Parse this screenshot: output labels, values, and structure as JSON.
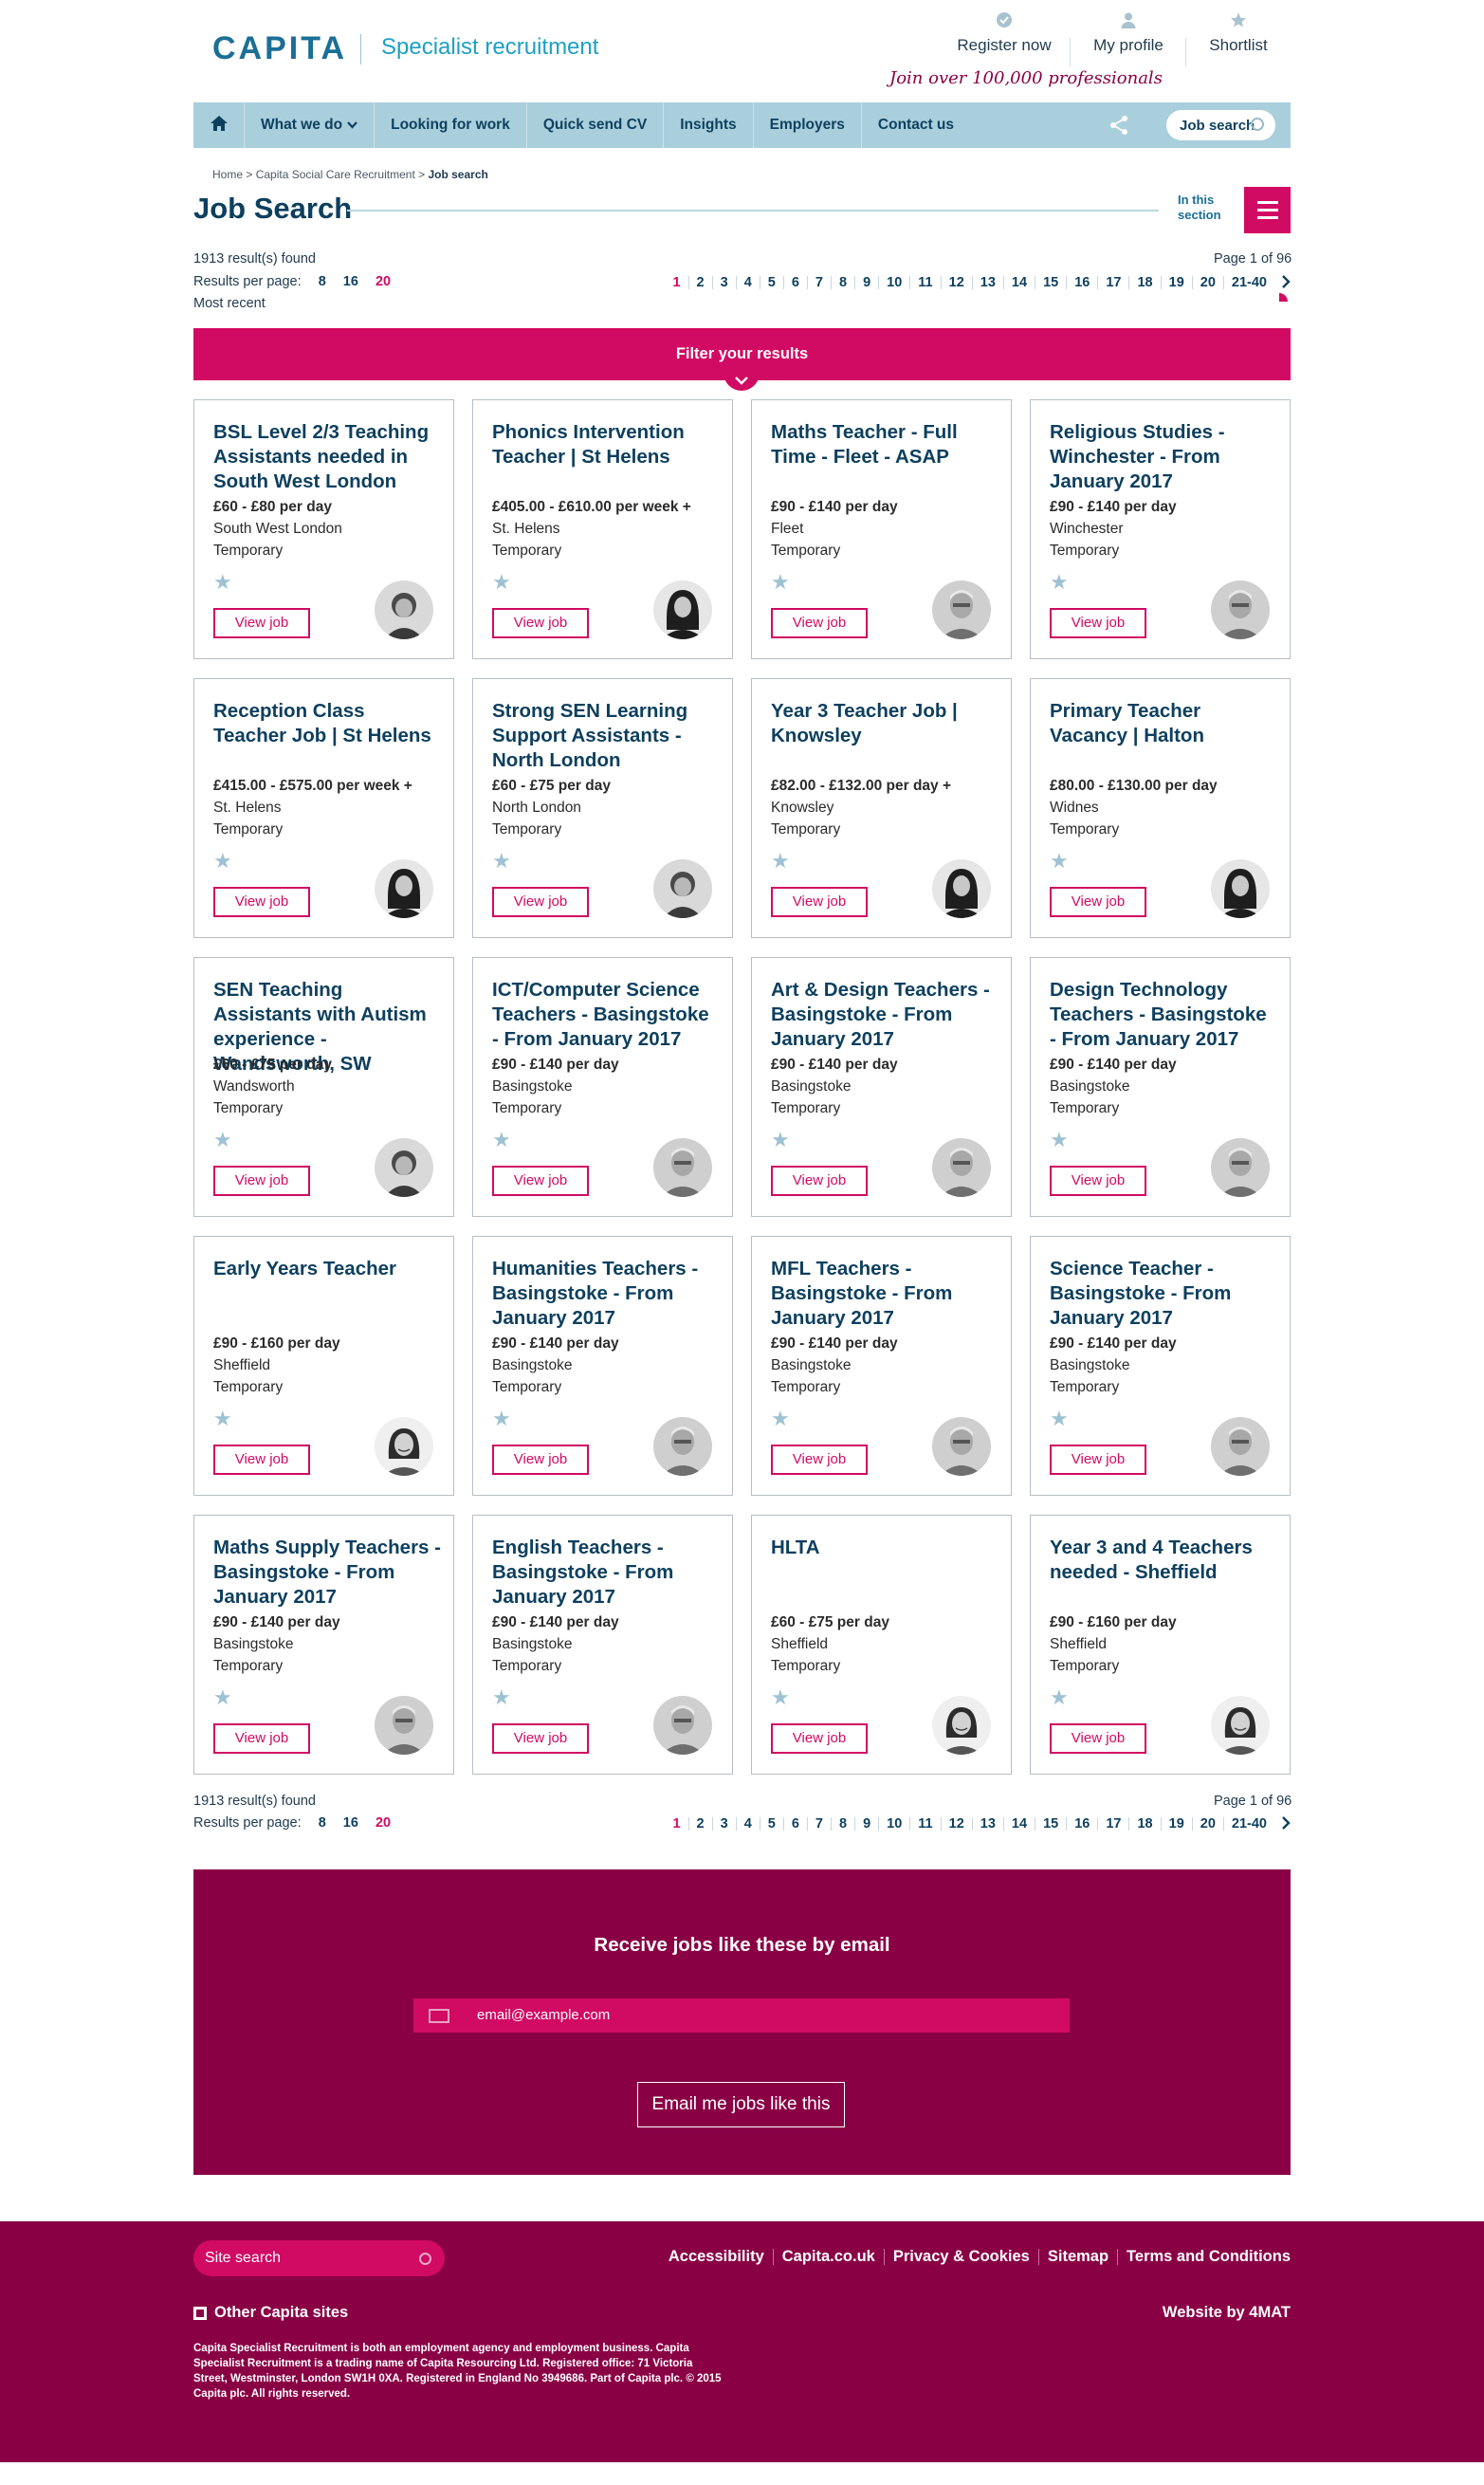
{
  "header": {
    "logo": "CAPITA",
    "tagline": "Specialist recruitment",
    "links": [
      {
        "label": "Register now",
        "icon": "check-icon"
      },
      {
        "label": "My profile",
        "icon": "person-icon"
      },
      {
        "label": "Shortlist",
        "icon": "star-icon"
      }
    ],
    "join_text": "Join over 100,000 professionals"
  },
  "nav": {
    "items": [
      "What we do",
      "Looking for work",
      "Quick send CV",
      "Insights",
      "Employers",
      "Contact us"
    ],
    "search_label": "Job search"
  },
  "breadcrumb": {
    "home": "Home",
    "section": "Capita Social Care Recruitment",
    "current": "Job search"
  },
  "page": {
    "title": "Job Search",
    "in_section": "In this section",
    "results_found": "1913 result(s) found",
    "results_per_page_label": "Results per page:",
    "per_page_options": [
      "8",
      "16",
      "20"
    ],
    "per_page_active": "20",
    "sort": "Most recent",
    "page_of": "Page 1 of 96",
    "pages": [
      "1",
      "2",
      "3",
      "4",
      "5",
      "6",
      "7",
      "8",
      "9",
      "10",
      "11",
      "12",
      "13",
      "14",
      "15",
      "16",
      "17",
      "18",
      "19",
      "20",
      "21-40"
    ],
    "active_page": "1"
  },
  "filter": {
    "label": "Filter your results"
  },
  "view_job_label": "View job",
  "jobs": [
    {
      "title": "BSL Level 2/3 Teaching Assistants needed in South West London",
      "salary": "£60 - £80 per day",
      "location": "South West London",
      "type": "Temporary",
      "avatar": "woman-short"
    },
    {
      "title": "Phonics Intervention Teacher | St Helens",
      "salary": "£405.00 - £610.00 per week +",
      "location": "St. Helens",
      "type": "Temporary",
      "avatar": "woman-dark"
    },
    {
      "title": "Maths Teacher - Full Time - Fleet - ASAP",
      "salary": "£90 - £140 per day",
      "location": "Fleet",
      "type": "Temporary",
      "avatar": "man-grey"
    },
    {
      "title": "Religious Studies - Winchester - From January 2017",
      "salary": "£90 - £140 per day",
      "location": "Winchester",
      "type": "Temporary",
      "avatar": "man-grey"
    },
    {
      "title": "Reception Class Teacher Job | St Helens",
      "salary": "£415.00 - £575.00 per week +",
      "location": "St. Helens",
      "type": "Temporary",
      "avatar": "woman-dark"
    },
    {
      "title": "Strong SEN Learning Support Assistants - North London",
      "salary": "£60 - £75 per day",
      "location": "North London",
      "type": "Temporary",
      "avatar": "woman-short"
    },
    {
      "title": "Year 3 Teacher Job | Knowsley",
      "salary": "£82.00 - £132.00 per day +",
      "location": "Knowsley",
      "type": "Temporary",
      "avatar": "woman-dark"
    },
    {
      "title": "Primary Teacher Vacancy | Halton",
      "salary": "£80.00 - £130.00 per day",
      "location": "Widnes",
      "type": "Temporary",
      "avatar": "woman-dark"
    },
    {
      "title": "SEN Teaching Assistants with Autism experience - Wandsworth, SW",
      "salary": "£60 - £75 per day",
      "location": "Wandsworth",
      "type": "Temporary",
      "avatar": "woman-short"
    },
    {
      "title": "ICT/Computer Science Teachers - Basingstoke - From January 2017",
      "salary": "£90 - £140 per day",
      "location": "Basingstoke",
      "type": "Temporary",
      "avatar": "man-grey"
    },
    {
      "title": "Art & Design Teachers - Basingstoke - From January 2017",
      "salary": "£90 - £140 per day",
      "location": "Basingstoke",
      "type": "Temporary",
      "avatar": "man-grey"
    },
    {
      "title": "Design Technology Teachers - Basingstoke - From January 2017",
      "salary": "£90 - £140 per day",
      "location": "Basingstoke",
      "type": "Temporary",
      "avatar": "man-grey"
    },
    {
      "title": "Early Years Teacher",
      "salary": "£90 - £160 per day",
      "location": "Sheffield",
      "type": "Temporary",
      "avatar": "woman-smile"
    },
    {
      "title": "Humanities Teachers - Basingstoke - From January 2017",
      "salary": "£90 - £140 per day",
      "location": "Basingstoke",
      "type": "Temporary",
      "avatar": "man-grey"
    },
    {
      "title": "MFL Teachers - Basingstoke - From January 2017",
      "salary": "£90 - £140 per day",
      "location": "Basingstoke",
      "type": "Temporary",
      "avatar": "man-grey"
    },
    {
      "title": "Science Teacher - Basingstoke - From January 2017",
      "salary": "£90 - £140 per day",
      "location": "Basingstoke",
      "type": "Temporary",
      "avatar": "man-grey"
    },
    {
      "title": "Maths Supply Teachers - Basingstoke - From January 2017",
      "salary": "£90 - £140 per day",
      "location": "Basingstoke",
      "type": "Temporary",
      "avatar": "man-grey"
    },
    {
      "title": "English Teachers - Basingstoke - From January 2017",
      "salary": "£90 - £140 per day",
      "location": "Basingstoke",
      "type": "Temporary",
      "avatar": "man-grey"
    },
    {
      "title": "HLTA",
      "salary": "£60 - £75 per day",
      "location": "Sheffield",
      "type": "Temporary",
      "avatar": "woman-smile"
    },
    {
      "title": "Year 3 and 4 Teachers needed - Sheffield",
      "salary": "£90 - £160 per day",
      "location": "Sheffield",
      "type": "Temporary",
      "avatar": "woman-smile"
    }
  ],
  "email_signup": {
    "title": "Receive jobs like these by email",
    "placeholder": "email@example.com",
    "button": "Email me jobs like this"
  },
  "footer": {
    "search_placeholder": "Site search",
    "links": [
      "Accessibility",
      "Capita.co.uk",
      "Privacy & Cookies",
      "Sitemap",
      "Terms and Conditions"
    ],
    "other_sites": "Other Capita sites",
    "website_by": "Website by 4MAT",
    "legal": "Capita Specialist Recruitment is both an employment agency and employment business. Capita Specialist Recruitment is a trading name of Capita Resourcing Ltd. Registered office: 71 Victoria Street, Westminster, London SW1H 0XA. Registered in England No 3949686. Part of Capita plc. © 2015 Capita plc. All rights reserved."
  },
  "colors": {
    "brand_pink": "#d10a63",
    "brand_maroon": "#8a0045",
    "nav_blue": "#a9cfdc",
    "text_navy": "#0d3f5e"
  }
}
